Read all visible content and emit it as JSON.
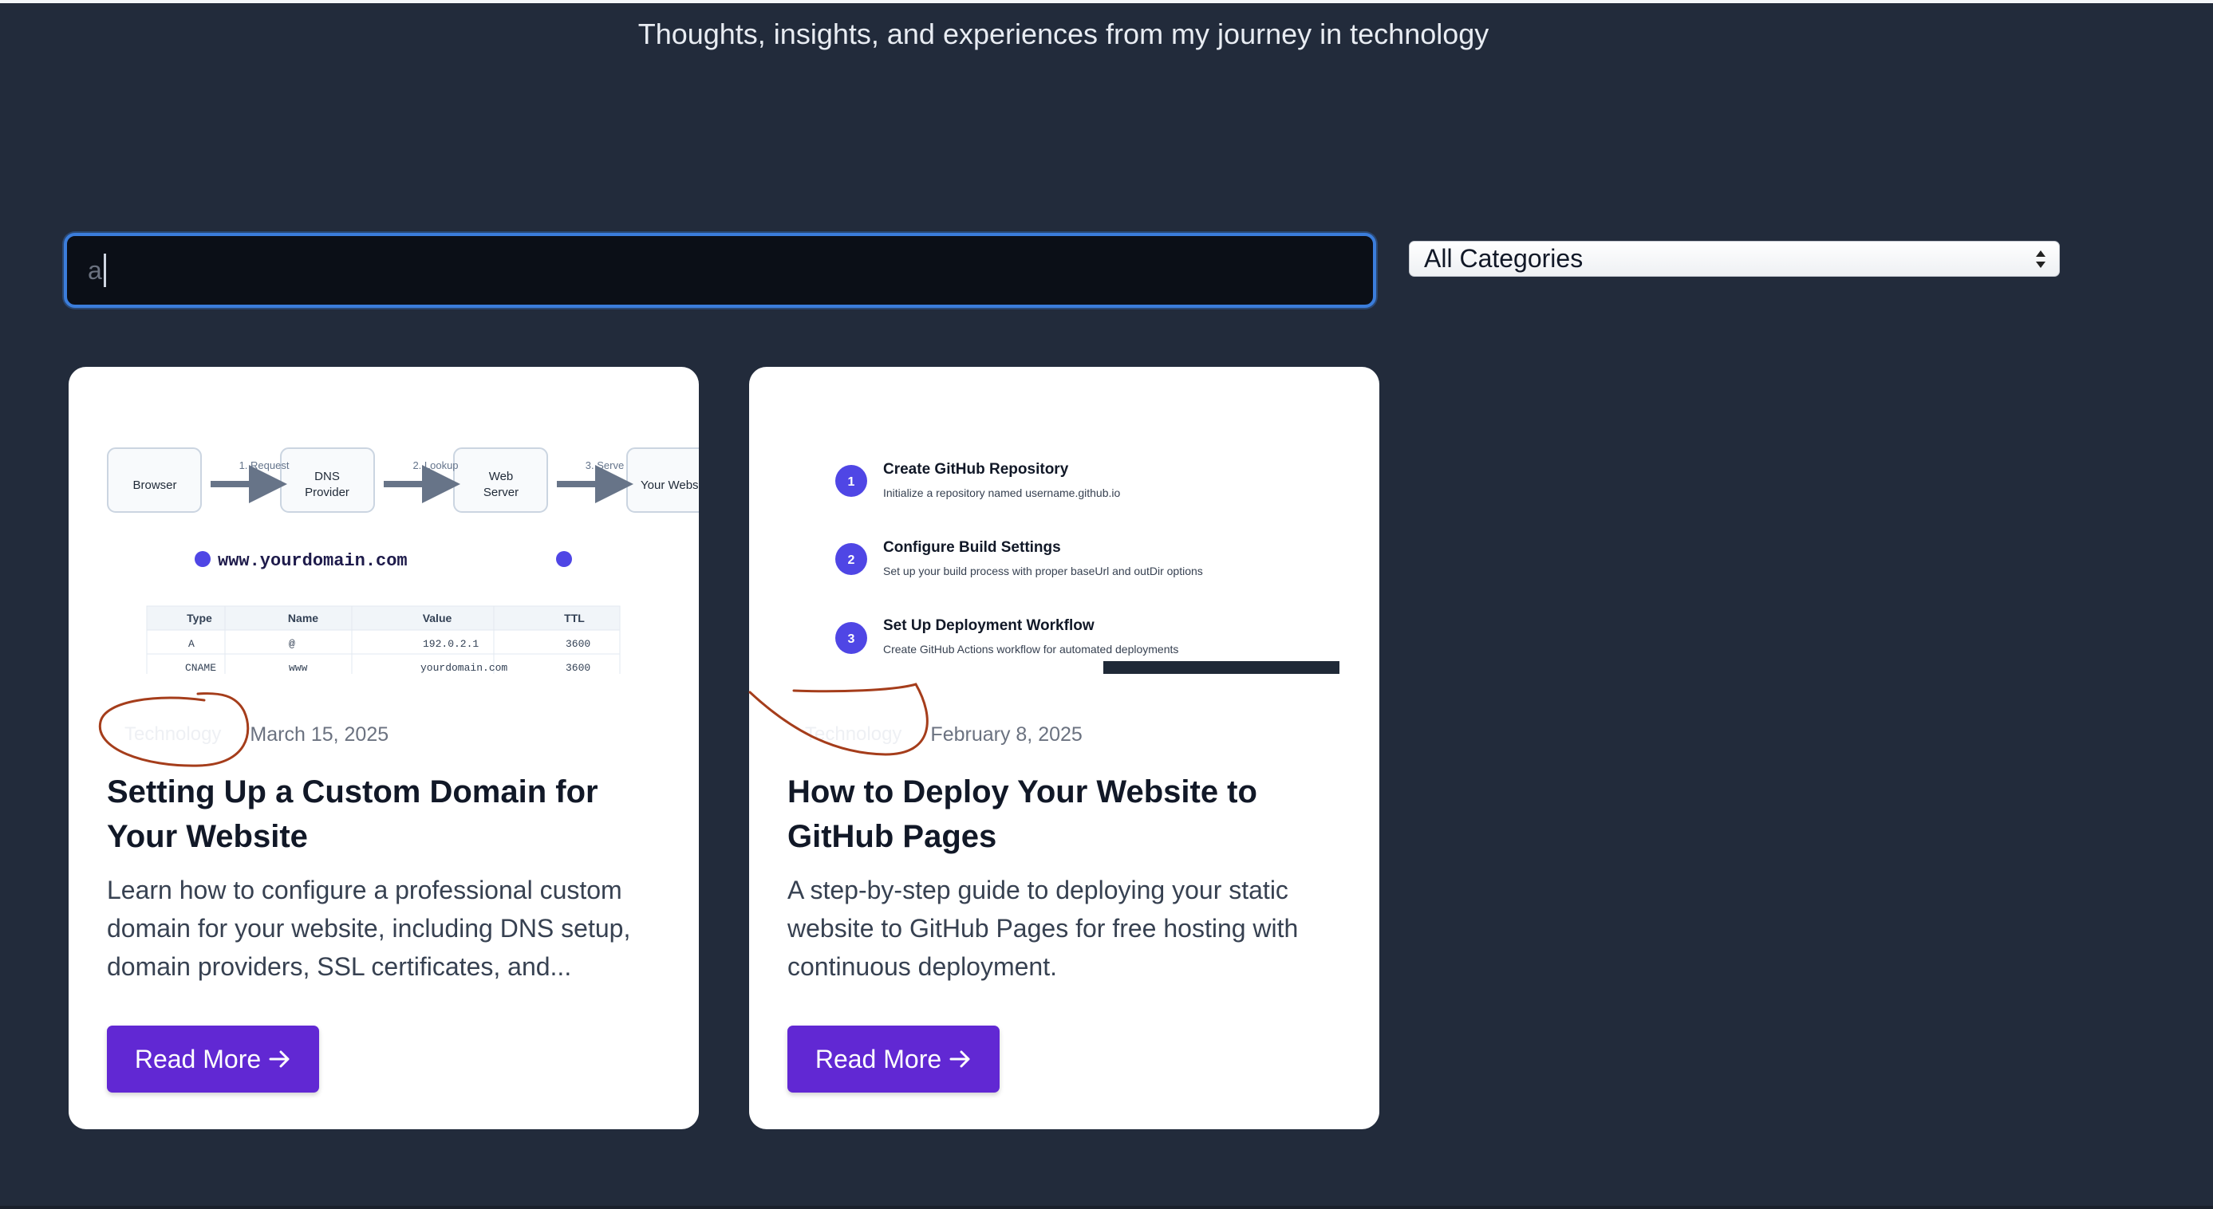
{
  "header": {
    "subtitle": "Thoughts, insights, and experiences from my journey in technology"
  },
  "search": {
    "value": "a",
    "placeholder": ""
  },
  "category_filter": {
    "selected": "All Categories"
  },
  "posts": [
    {
      "category": "Technology",
      "date": "March 15, 2025",
      "title": "Setting Up a Custom Domain for Your Website",
      "excerpt": "Learn how to configure a professional custom domain for your website, including DNS setup, domain providers, SSL certificates, and...",
      "read_more_label": "Read More",
      "illustration": {
        "nodes": [
          "Browser",
          "DNS",
          "Provider",
          "Web",
          "Server",
          "Your Website"
        ],
        "steps": [
          "1. Request",
          "2. Lookup",
          "3. Serve"
        ],
        "domain": "www.yourdomain.com",
        "table_headers": [
          "Type",
          "Name",
          "Value",
          "TTL"
        ],
        "table_rows": [
          [
            "A",
            "@",
            "192.0.2.1",
            "3600"
          ],
          [
            "CNAME",
            "www",
            "yourdomain.com",
            "3600"
          ]
        ]
      }
    },
    {
      "category": "Technology",
      "date": "February 8, 2025",
      "title": "How to Deploy Your Website to GitHub Pages",
      "excerpt": "A step-by-step guide to deploying your static website to GitHub Pages for free hosting with continuous deployment.",
      "read_more_label": "Read More",
      "illustration": {
        "steps": [
          {
            "num": "1",
            "title": "Create GitHub Repository",
            "desc": "Initialize a repository named username.github.io"
          },
          {
            "num": "2",
            "title": "Configure Build Settings",
            "desc": "Set up your build process with proper baseUrl and outDir options"
          },
          {
            "num": "3",
            "title": "Set Up Deployment Workflow",
            "desc": "Create GitHub Actions workflow for automated deployments"
          }
        ]
      }
    }
  ],
  "colors": {
    "background": "#222b3b",
    "accent": "#6128d3",
    "focus_ring": "#3b7ddb",
    "step_circle": "#4f46e5",
    "annotation": "#a53d1b"
  }
}
